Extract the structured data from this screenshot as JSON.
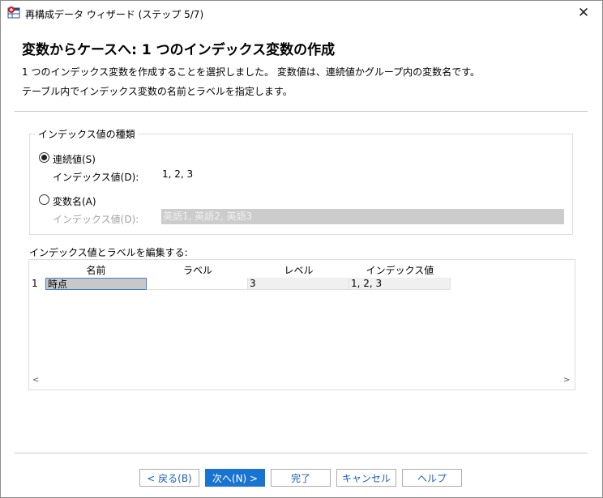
{
  "window": {
    "title": "再構成データ ウィザード (ステップ 5/7)",
    "close_glyph": "✕",
    "app_icon": "data-restructure-icon"
  },
  "header": {
    "title": "変数からケースへ: 1 つのインデックス変数の作成",
    "desc_line1": "1 つのインデックス変数を作成することを選択しました。 変数値は、連続値かグループ内の変数名です。",
    "desc_line2": "テーブル内でインデックス変数の名前とラベルを指定します。"
  },
  "index_type": {
    "legend": "インデックス値の種類",
    "sequential": {
      "label": "連続値(S)",
      "checked": true,
      "values_label": "インデックス値(D):",
      "values": "1, 2, 3"
    },
    "variable_names": {
      "label": "変数名(A)",
      "checked": false,
      "values_label": "インデックス値(D):",
      "values": "英語1, 英語2, 英語3"
    }
  },
  "grid": {
    "label": "インデックス値とラベルを編集する:",
    "columns": [
      "名前",
      "ラベル",
      "レベル",
      "インデックス値"
    ],
    "rows": [
      {
        "num": "1",
        "name": "時点",
        "label": "",
        "level": "3",
        "index_values": "1, 2, 3"
      }
    ],
    "scroll_left": "<",
    "scroll_right": ">"
  },
  "buttons": {
    "back": "< 戻る(B)",
    "next": "次へ(N) >",
    "finish": "完了",
    "cancel": "キャンセル",
    "help": "ヘルプ"
  },
  "colors": {
    "primary": "#1874d0",
    "disabled_field": "#cccccc"
  }
}
